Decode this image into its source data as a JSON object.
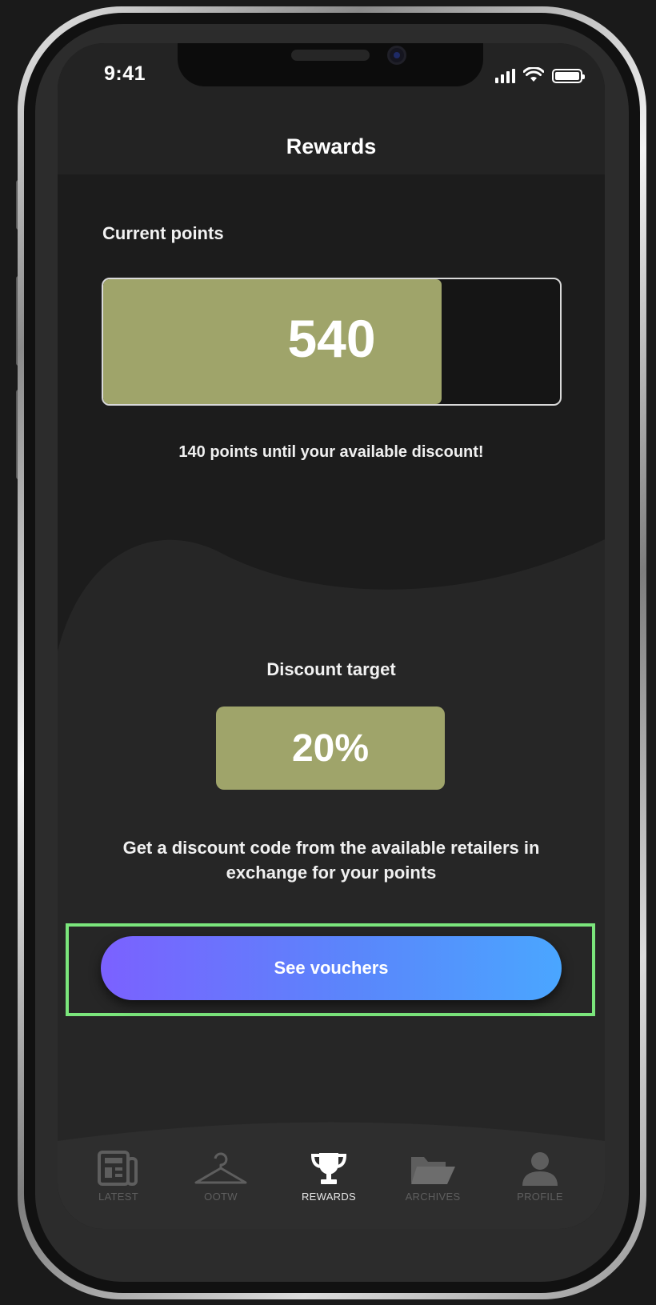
{
  "status_bar": {
    "time": "9:41"
  },
  "nav": {
    "title": "Rewards"
  },
  "points": {
    "label": "Current points",
    "value": "540",
    "fill_fraction": 0.74,
    "hint": "140 points until your available discount!"
  },
  "discount": {
    "label": "Discount target",
    "value": "20%",
    "description": "Get a discount code from the available retailers in exchange for your points"
  },
  "cta": {
    "label": "See vouchers"
  },
  "tabs": [
    {
      "label": "LATEST",
      "icon": "newspaper-icon",
      "active": false
    },
    {
      "label": "OOTW",
      "icon": "hanger-icon",
      "active": false
    },
    {
      "label": "REWARDS",
      "icon": "trophy-icon",
      "active": true
    },
    {
      "label": "ARCHIVES",
      "icon": "folder-icon",
      "active": false
    },
    {
      "label": "PROFILE",
      "icon": "user-icon",
      "active": false
    }
  ],
  "colors": {
    "accent_olive": "#9fa46a",
    "button_gradient_start": "#7b61ff",
    "button_gradient_end": "#4aa6ff",
    "highlight": "#7be67c"
  }
}
